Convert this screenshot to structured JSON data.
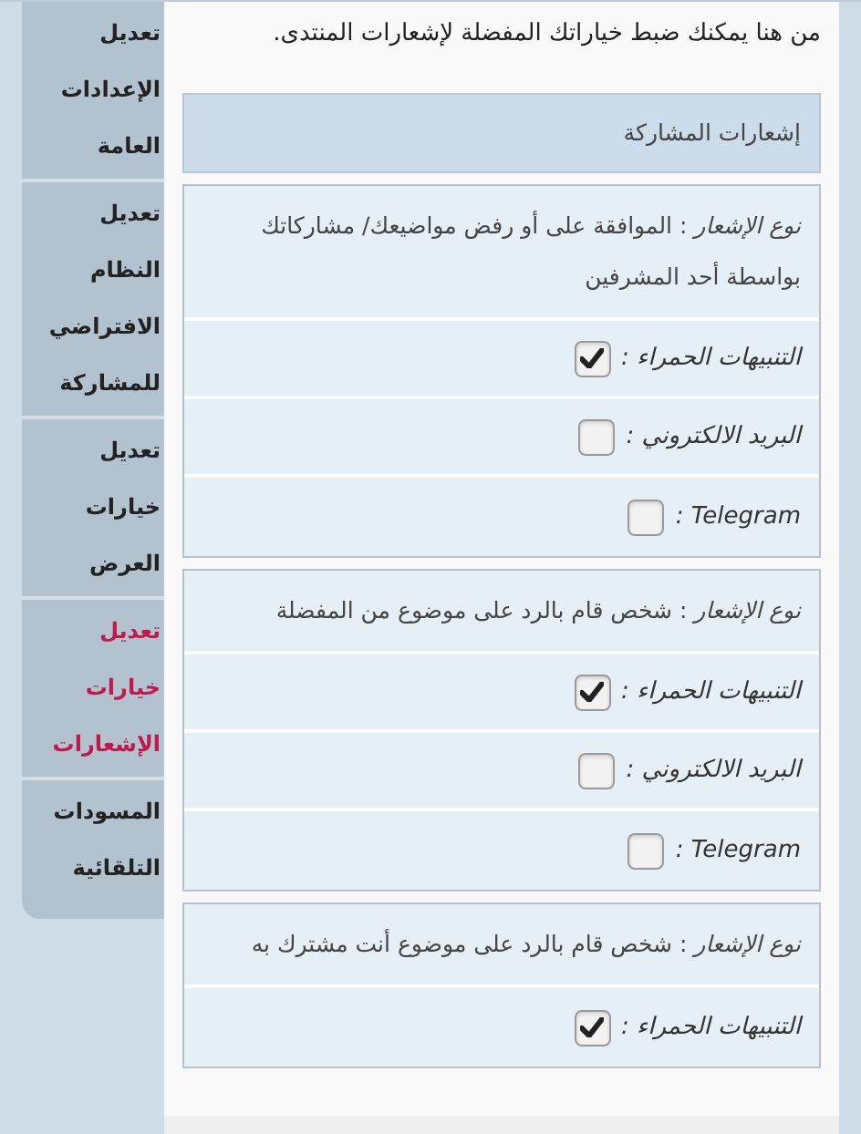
{
  "intro": "من هنا يمكنك ضبط خياراتك المفضلة لإشعارات المنتدى.",
  "sidebar": {
    "items": [
      {
        "label": "تعديل الإعدادات العامة",
        "selected": false
      },
      {
        "label": "تعديل النظام الافتراضي للمشاركة",
        "selected": false
      },
      {
        "label": "تعديل خيارات العرض",
        "selected": false
      },
      {
        "label": "تعديل خيارات الإشعارات",
        "selected": true
      },
      {
        "label": "المسودات التلقائية",
        "selected": false
      }
    ]
  },
  "section_title": "إشعارات المشاركة",
  "groups": [
    {
      "type_label": "*نوع الإشعار* : الموافقة على أو رفض مواضيعك/ مشاركاتك بواسطة أحد المشرفين",
      "options": [
        {
          "label": "التنبيهات الحمراء :",
          "checked": true
        },
        {
          "label": "البريد الالكتروني :",
          "checked": false
        },
        {
          "label": "Telegram :",
          "checked": false
        }
      ]
    },
    {
      "type_label": "*نوع الإشعار* : شخص قام بالرد على موضوع من المفضلة",
      "options": [
        {
          "label": "التنبيهات الحمراء :",
          "checked": true
        },
        {
          "label": "البريد الالكتروني :",
          "checked": false
        },
        {
          "label": "Telegram :",
          "checked": false
        }
      ]
    },
    {
      "type_label": "*نوع الإشعار* : شخص قام بالرد على موضوع أنت مشترك به",
      "options": [
        {
          "label": "التنبيهات الحمراء :",
          "checked": true
        }
      ]
    }
  ]
}
